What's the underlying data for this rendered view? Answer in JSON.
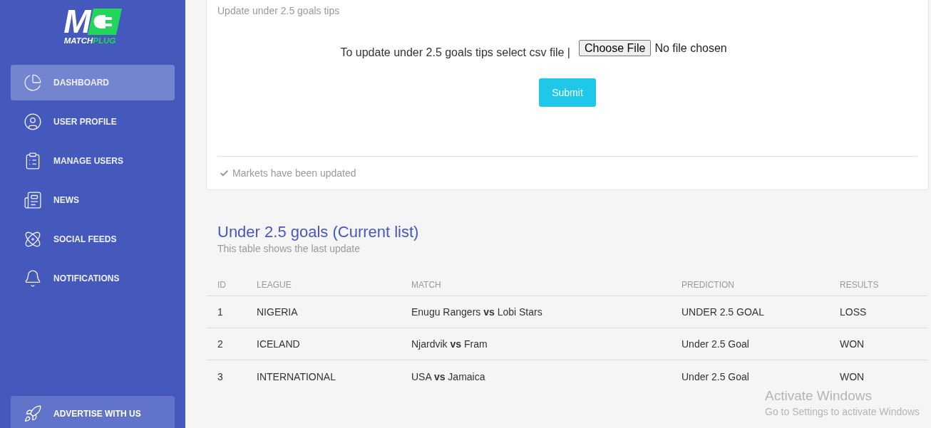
{
  "logo": {
    "mark": "M",
    "wordmark": [
      {
        "text": "MATCH",
        "color": "#ffffff"
      },
      {
        "text": "PLUG",
        "color": "#22d65a"
      }
    ]
  },
  "sidebar": {
    "items": [
      {
        "label": "DASHBOARD",
        "selected": true
      },
      {
        "label": "USER PROFILE",
        "selected": false
      },
      {
        "label": "MANAGE USERS",
        "selected": false
      },
      {
        "label": "NEWS",
        "selected": false
      },
      {
        "label": "SOCIAL FEEDS",
        "selected": false
      },
      {
        "label": "NOTIFICATIONS",
        "selected": false
      }
    ],
    "promo_button": {
      "label": "ADVERTISE WITH US"
    }
  },
  "upload_card": {
    "subtitle": "Update under 2.5 goals tips",
    "field_label": "To update under 2.5 goals tips select csv file |",
    "file_input": {
      "button": "Choose File",
      "status": "No file chosen"
    },
    "submit": "Submit",
    "footer": "Markets have been updated"
  },
  "list_section": {
    "title": "Under 2.5 goals (Current list)",
    "subtitle": "This table shows the last update"
  },
  "table": {
    "columns": [
      "ID",
      "LEAGUE",
      "MATCH",
      "PREDICTION",
      "RESULTS"
    ],
    "rows": [
      {
        "id": "1",
        "league": "NIGERIA",
        "match": "Enugu Rangers **vs** Lobi Stars",
        "prediction": "UNDER 2.5 GOAL",
        "result": "LOSS"
      },
      {
        "id": "2",
        "league": "ICELAND",
        "match": "Njardvik **vs** Fram",
        "prediction": "Under 2.5 Goal",
        "result": "WON"
      },
      {
        "id": "3",
        "league": "INTERNATIONAL",
        "match": "USA **vs** Jamaica",
        "prediction": "Under 2.5 Goal",
        "result": "WON"
      }
    ]
  },
  "windows_activation": {
    "title": "Activate Windows",
    "message": "Go to Settings to activate Windows"
  }
}
